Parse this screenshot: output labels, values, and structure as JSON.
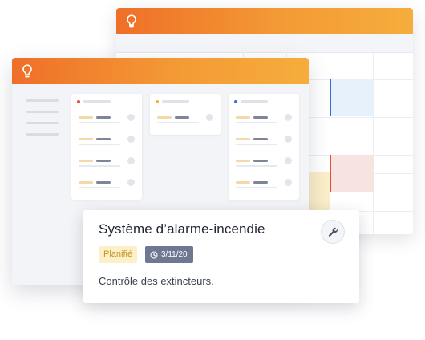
{
  "colors": {
    "titlebar_start": "#ef6f28",
    "titlebar_end": "#f6ad3c",
    "status_badge_bg": "#fdf0c9",
    "status_badge_text": "#c29326",
    "date_badge_bg": "#6e7891",
    "event_blue": "#2f6fd6",
    "event_red": "#e0503a"
  },
  "icons": {
    "logo": "lightbulb-icon",
    "tool": "wrench-icon",
    "clock": "clock-icon"
  },
  "board": {
    "columns": [
      {
        "dot_color": "#e74c3c",
        "cards": 4
      },
      {
        "dot_color": "#f0b429",
        "cards": 1
      },
      {
        "dot_color": "#3b6fd8",
        "cards": 4
      }
    ]
  },
  "popup": {
    "title": "Système d’alarme-incendie",
    "status": "Planifié",
    "date": "3/11/20",
    "description": "Contrôle des extincteurs."
  }
}
